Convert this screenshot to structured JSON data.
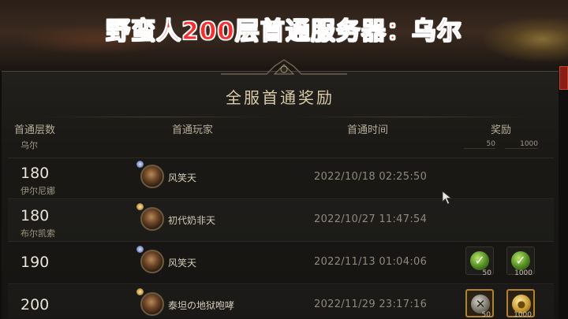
{
  "overlay": {
    "title": "野蛮人200层首通服务器：乌尔"
  },
  "panel": {
    "title": "全服首通奖励",
    "columns": {
      "floor": "首通层数",
      "player": "首通玩家",
      "time": "首通时间",
      "reward": "奖励"
    }
  },
  "partial_row": {
    "name": "乌尔",
    "reward_amounts": [
      "50",
      "1000"
    ]
  },
  "rows": [
    {
      "floor": "180",
      "server": "伊尔尼娜",
      "player": "风笑天",
      "time": "2022/10/18 02:25:50",
      "rewards": []
    },
    {
      "floor": "180",
      "server": "布尔凯索",
      "player": "初代奶非天",
      "time": "2022/10/27 11:47:54",
      "rewards": []
    },
    {
      "floor": "190",
      "server": "",
      "player": "风笑天",
      "time": "2022/11/13 01:04:06",
      "rewards": [
        {
          "icon": "check-icon",
          "amount": "50"
        },
        {
          "icon": "check-icon",
          "amount": "1000"
        }
      ]
    },
    {
      "floor": "200",
      "server": "",
      "player": "泰坦の地狱咆哮",
      "time": "2022/11/29 23:17:16",
      "rewards": [
        {
          "icon": "crossed-swords-icon",
          "amount": "50"
        },
        {
          "icon": "gold-coin-icon",
          "amount": "1000"
        }
      ]
    }
  ],
  "colors": {
    "overlay_title": "#ff2a2a",
    "panel_bg": "#1a1916",
    "accent_gold": "#b0832a"
  }
}
